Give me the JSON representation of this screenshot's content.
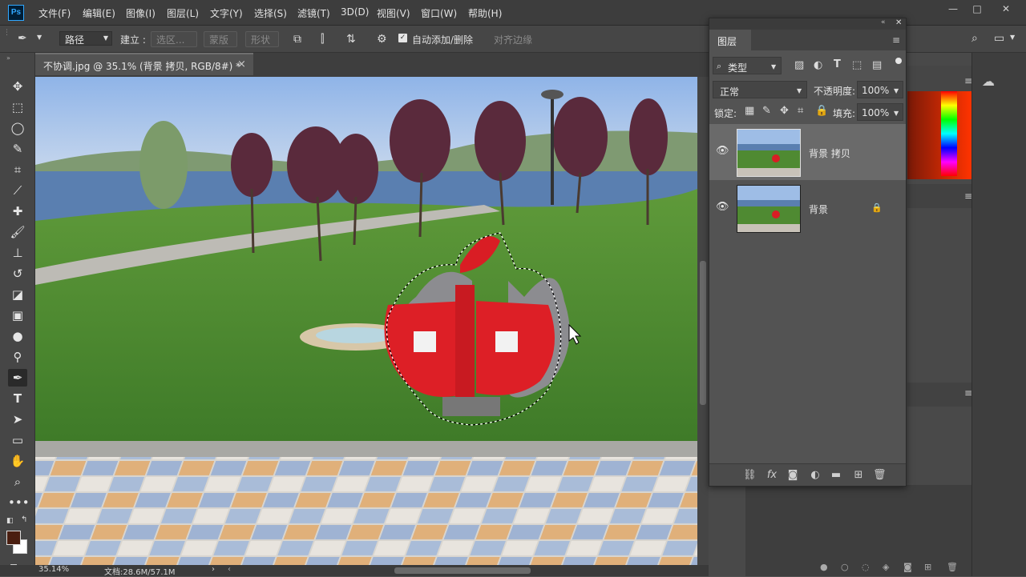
{
  "app": {
    "logo": "Ps",
    "menu": [
      "文件(F)",
      "编辑(E)",
      "图像(I)",
      "图层(L)",
      "文字(Y)",
      "选择(S)",
      "滤镜(T)",
      "3D(D)",
      "视图(V)",
      "窗口(W)",
      "帮助(H)"
    ],
    "window_controls": {
      "minimize": "—",
      "restore": "□",
      "close": "✕"
    }
  },
  "options_bar": {
    "mode_value": "路径",
    "build_label": "建立 :",
    "selection_btn": "选区...",
    "mask_btn": "蒙版",
    "shape_btn": "形状",
    "auto_add_delete": "自动添加/删除",
    "auto_add_checked": true,
    "align_edges": "对齐边缘"
  },
  "document": {
    "tab_title": "不协调.jpg @ 35.1% (背景 拷贝, RGB/8#) *",
    "tab_close": "×",
    "zoom": "35.14%",
    "doc_size": "文档:28.6M/57.1M"
  },
  "layers_panel": {
    "title": "图层",
    "filter_kind": "类型",
    "blend_mode": "正常",
    "opacity_label": "不透明度:",
    "opacity_value": "100%",
    "lock_label": "锁定:",
    "fill_label": "填充:",
    "fill_value": "100%",
    "layers": [
      {
        "name": "背景 拷贝",
        "visible": true,
        "selected": true,
        "locked": false
      },
      {
        "name": "背景",
        "visible": true,
        "selected": false,
        "locked": true
      }
    ]
  },
  "colors": {
    "foreground": "#4a1e10",
    "background": "#ffffff",
    "accent": "#31a8ff"
  }
}
